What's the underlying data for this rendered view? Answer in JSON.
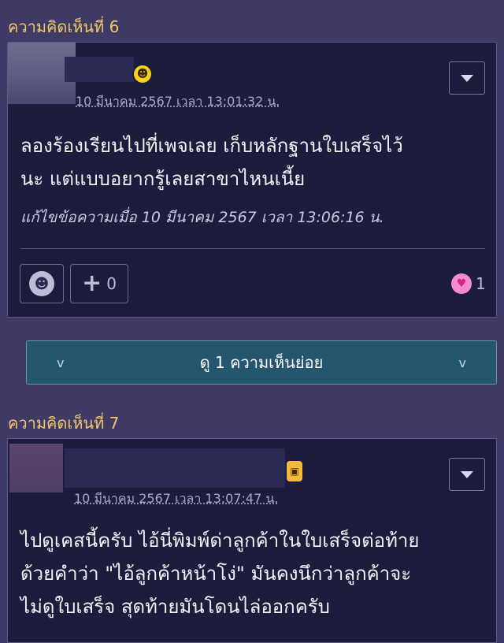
{
  "comments": [
    {
      "header": "ความคิดเห็นที่ 6",
      "timestamp": "10 มีนาคม 2567 เวลา 13:01:32 น.",
      "body_lines": [
        "ลองร้องเรียนไปที่เพจเลย เก็บหลักฐานใบเสร็จไว้",
        "นะ แต่แบบอยากรู้เลยสาขาไหนเนี้ย"
      ],
      "edit_note": "แก้ไขข้อความเมื่อ 10 มีนาคม 2567 เวลา 13:06:16 น.",
      "plus_count": "0",
      "like_count": "1",
      "member_icon": "smiley-emoji-icon"
    },
    {
      "header": "ความคิดเห็นที่ 7",
      "timestamp": "10 มีนาคม 2567 เวลา 13:07:47 น.",
      "body_lines": [
        "ไปดูเคสนี้ครับ  ไอ้นี่พิมพ์ด่าลูกค้าในใบเสร็จต่อท้าย",
        "ด้วยคำว่า \"ไอ้ลูกค้าหน้าโง่\"    มันคงนึกว่าลูกค้าจะ",
        "ไม่ดูใบเสร็จ  สุดท้ายมันโดนไล่ออกครับ"
      ],
      "member_icon": "walkie-talkie-icon"
    }
  ],
  "reply_bar": {
    "label": "ดู 1 ความเห็นย่อย",
    "left_chevron": "v",
    "right_chevron": "v"
  },
  "colors": {
    "page_bg": "#3f3a66",
    "card_bg": "#1d1c3d",
    "header_text": "#f3c86a",
    "reply_bar_bg": "#24566f"
  }
}
